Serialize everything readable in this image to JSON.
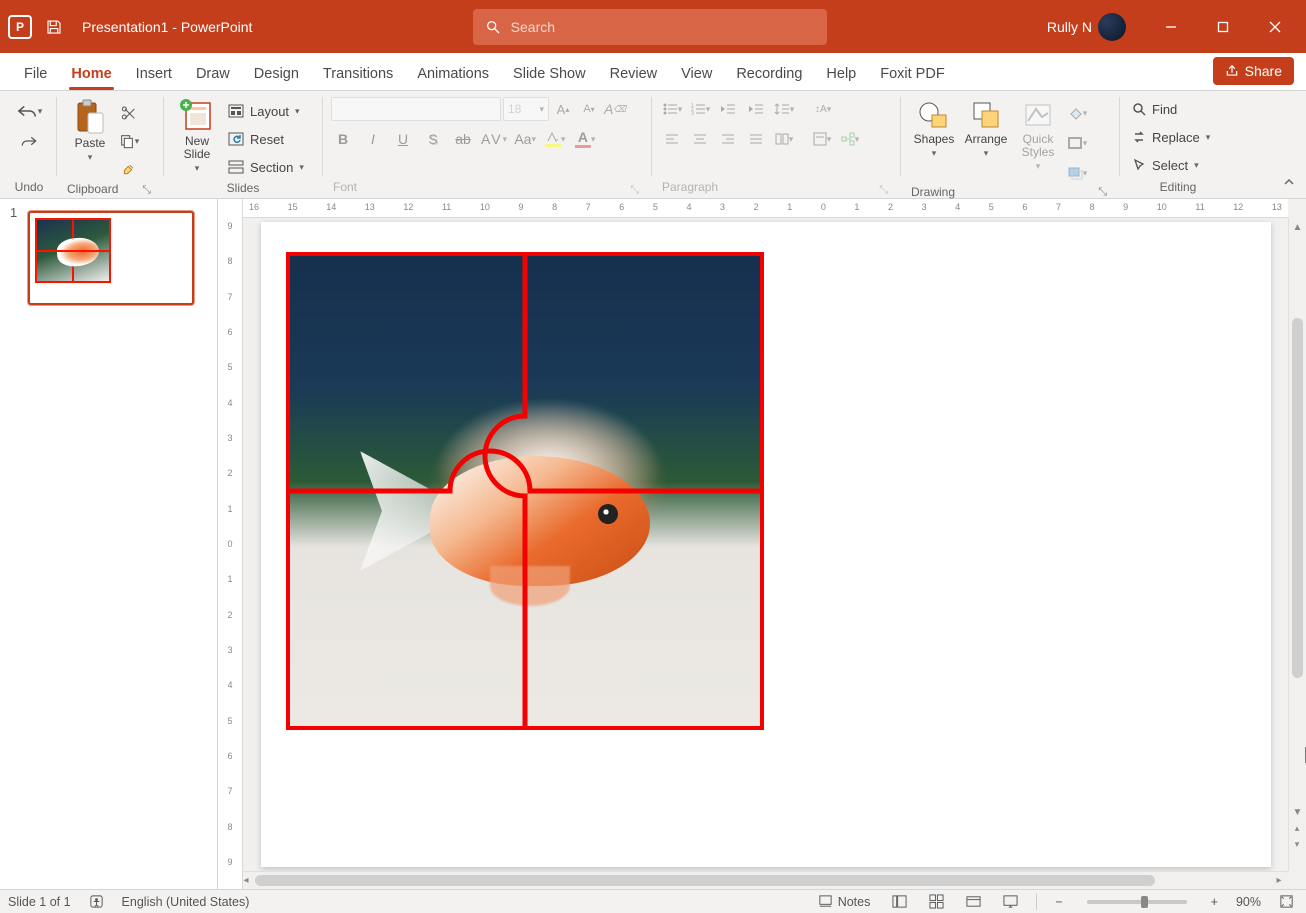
{
  "titlebar": {
    "doc_title": "Presentation1",
    "app_suffix": "  -  PowerPoint",
    "search_placeholder": "Search",
    "user_name": "Rully N"
  },
  "tabs": [
    "File",
    "Home",
    "Insert",
    "Draw",
    "Design",
    "Transitions",
    "Animations",
    "Slide Show",
    "Review",
    "View",
    "Recording",
    "Help",
    "Foxit PDF"
  ],
  "active_tab": "Home",
  "share_label": "Share",
  "ribbon_groups": {
    "undo": "Undo",
    "clipboard": {
      "label": "Clipboard",
      "paste": "Paste"
    },
    "slides": {
      "label": "Slides",
      "new_slide": "New\nSlide",
      "layout": "Layout",
      "reset": "Reset",
      "section": "Section"
    },
    "font": {
      "label": "Font",
      "size_placeholder": "18"
    },
    "paragraph": "Paragraph",
    "drawing": {
      "label": "Drawing",
      "shapes": "Shapes",
      "arrange": "Arrange",
      "quick_styles": "Quick\nStyles"
    },
    "editing": {
      "label": "Editing",
      "find": "Find",
      "replace": "Replace",
      "select": "Select"
    }
  },
  "slide_number_thumb": "1",
  "ruler_h_labels": [
    "16",
    "15",
    "14",
    "13",
    "12",
    "11",
    "10",
    "9",
    "8",
    "7",
    "6",
    "5",
    "4",
    "3",
    "2",
    "1",
    "0",
    "1",
    "2",
    "3",
    "4",
    "5",
    "6",
    "7",
    "8",
    "9",
    "10",
    "11",
    "12",
    "13"
  ],
  "ruler_v_labels": [
    "9",
    "8",
    "7",
    "6",
    "5",
    "4",
    "3",
    "2",
    "1",
    "0",
    "1",
    "2",
    "3",
    "4",
    "5",
    "6",
    "7",
    "8",
    "9"
  ],
  "statusbar": {
    "slide_info": "Slide 1 of 1",
    "language": "English (United States)",
    "notes": "Notes",
    "zoom_pct": "90%"
  }
}
